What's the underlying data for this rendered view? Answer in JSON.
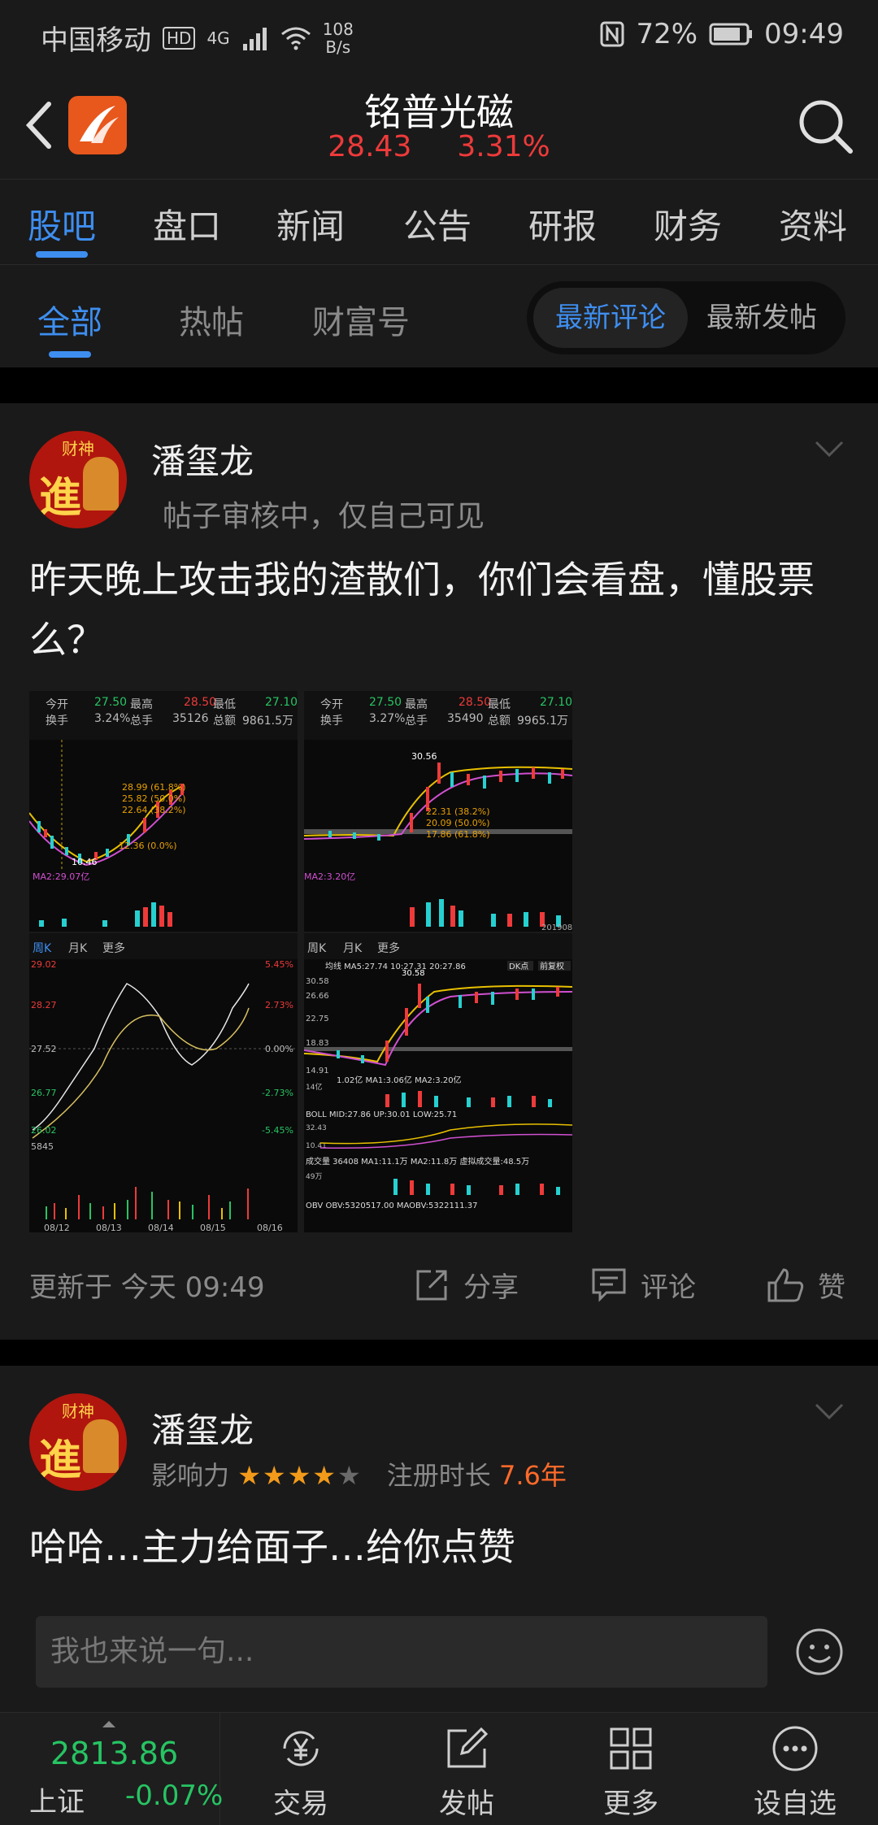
{
  "status_bar": {
    "carrier": "中国移动",
    "hd": "HD",
    "signal": "4G",
    "speed_value": "108",
    "speed_unit": "B/s",
    "battery": "72%",
    "time": "09:49"
  },
  "header": {
    "stock_name": "铭普光磁",
    "price": "28.43",
    "change_pct": "3.31%"
  },
  "main_tabs": [
    "股吧",
    "盘口",
    "新闻",
    "公告",
    "研报",
    "财务",
    "资料"
  ],
  "sub_tabs": [
    "全部",
    "热帖",
    "财富号"
  ],
  "sort_toggle": {
    "active": "最新评论",
    "other": "最新发帖"
  },
  "post1": {
    "avatar_text_top": "财神",
    "avatar_text_big": "進",
    "author": "潘玺龙",
    "status": "帖子审核中，仅自己可见",
    "content": "昨天晚上攻击我的渣散们，你们会看盘，懂股票么？",
    "images": {
      "left_top": {
        "labels": [
          "今开",
          "27.50",
          "最高",
          "28.50",
          "最低",
          "27.10",
          "换手",
          "3.24%",
          "总手",
          "35126",
          "总额",
          "9861.5万"
        ],
        "fib": [
          "28.99 (61.8%)",
          "25.82 (50.0%)",
          "22.64 (38.2%)",
          "12.36 (0.0%)"
        ],
        "low": "10.46",
        "ma": "MA2:29.07亿"
      },
      "right_top": {
        "labels": [
          "今开",
          "27.50",
          "最高",
          "28.50",
          "最低",
          "27.10",
          "换手",
          "3.27%",
          "总手",
          "35490",
          "总额",
          "9965.1万"
        ],
        "fib": [
          "30.56",
          "22.31 (38.2%)",
          "20.09 (50.0%)",
          "17.86 (61.8%)"
        ],
        "ma": "MA2:3.20亿",
        "date": "201908"
      },
      "left_bottom": {
        "tabs": [
          "周K",
          "月K",
          "更多"
        ],
        "prices": [
          "29.02",
          "28.27",
          "27.52",
          "26.77",
          "26.02"
        ],
        "pcts": [
          "5.45%",
          "2.73%",
          "0.00%",
          "-2.73%",
          "-5.45%"
        ],
        "vol": "5845",
        "dates": [
          "08/12",
          "08/13",
          "08/14",
          "08/15",
          "08/16"
        ]
      },
      "right_bottom": {
        "tabs": [
          "周K",
          "月K",
          "更多"
        ],
        "ma_line": "均线 MA5:27.74 10:27.31 20:27.86",
        "btns": [
          "DK点",
          "前复权"
        ],
        "prices": [
          "30.58",
          "26.66",
          "22.75",
          "18.83",
          "14.91"
        ],
        "high": "30.58",
        "vol_line": "1.02亿 MA1:3.06亿 MA2:3.20亿",
        "boll_line": "BOLL MID:27.86 UP:30.01 LOW:25.71",
        "boll_vals": [
          "32.43",
          "10.41"
        ],
        "cj_line": "成交量 36408 MA1:11.1万 MA2:11.8万 虚拟成交量:48.5万",
        "obv_line": "OBV OBV:5320517.00 MAOBV:5322111.37",
        "vol_max": "49万",
        "vol_max2": "14亿"
      }
    },
    "updated": "更新于 今天 09:49",
    "share": "分享",
    "comment": "评论",
    "like": "赞"
  },
  "post2": {
    "author": "潘玺龙",
    "influence_label": "影响力",
    "stars_on": "★★★★",
    "stars_off": "★",
    "reg_label": "注册时长",
    "reg_value": "7.6年",
    "content": "哈哈…主力给面子…给你点赞"
  },
  "comment_input": {
    "placeholder": "我也来说一句..."
  },
  "bottom_nav": {
    "index_value": "2813.86",
    "index_name": "上证",
    "index_change": "-0.07%",
    "items": [
      "交易",
      "发帖",
      "更多",
      "设自选"
    ]
  },
  "colors": {
    "accent": "#3e8ef0",
    "up": "#ee3a3a",
    "down": "#27c463",
    "star": "#f29a1a",
    "reg": "#ff6a2a"
  }
}
